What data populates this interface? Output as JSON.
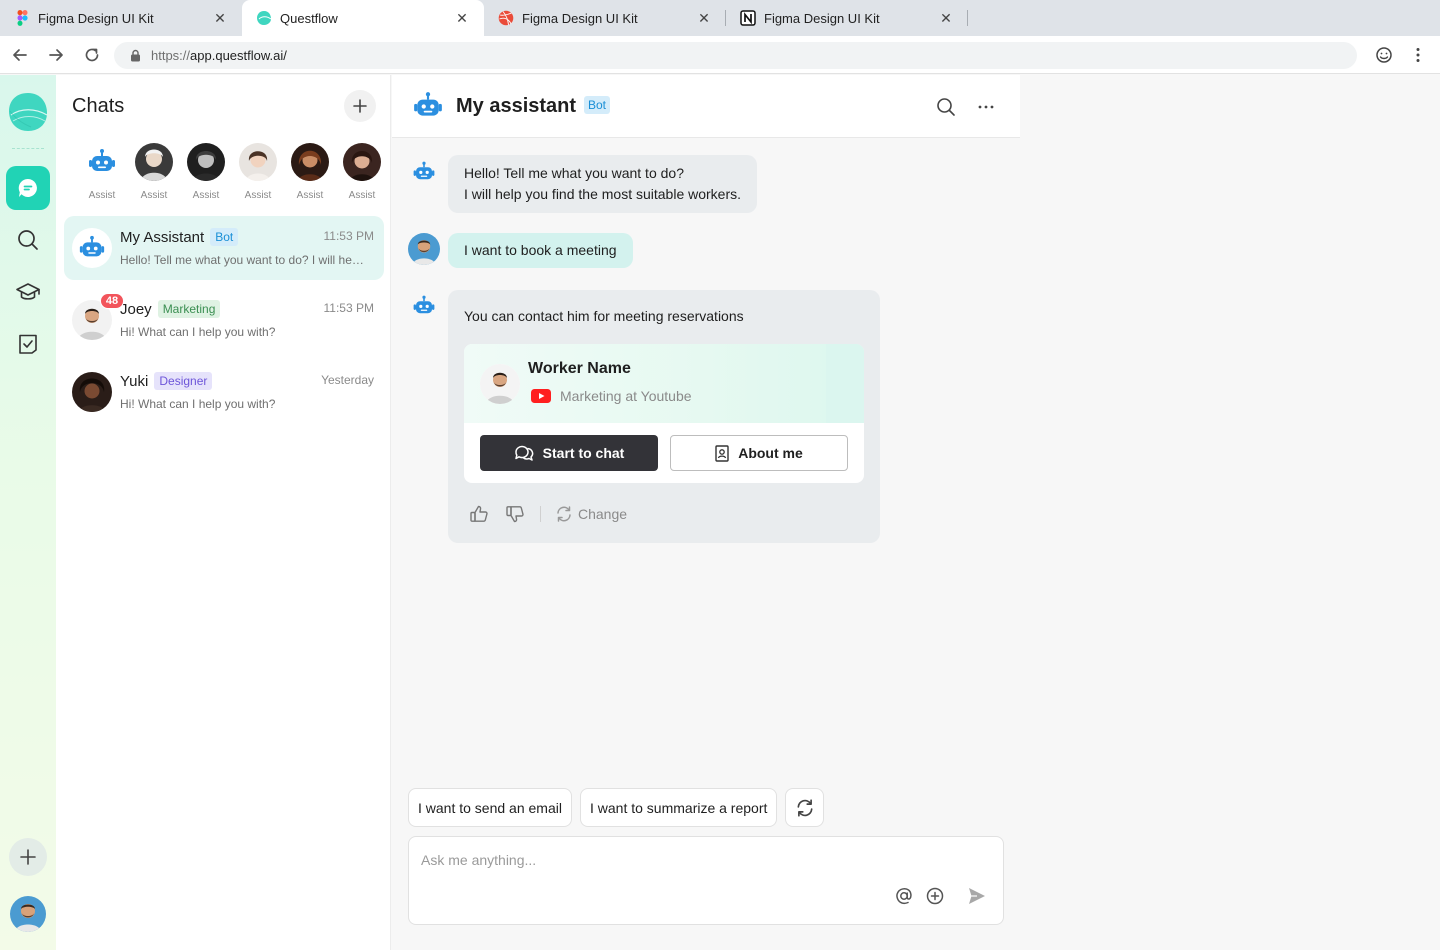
{
  "browser": {
    "tabs": [
      {
        "title": "Figma Design UI Kit",
        "icon": "figma-icon",
        "active": false
      },
      {
        "title": "Questflow",
        "icon": "questflow-icon",
        "active": true
      },
      {
        "title": "Figma Design UI Kit",
        "icon": "dribbble-icon",
        "active": false
      },
      {
        "title": "Figma Design UI Kit",
        "icon": "notion-icon",
        "active": false
      }
    ],
    "url_protocol": "https://",
    "url_host": "app.questflow.ai/"
  },
  "rail": {
    "items": [
      "chat-bubble-icon",
      "search-icon",
      "graduation-cap-icon",
      "checklist-icon"
    ]
  },
  "chats": {
    "title": "Chats",
    "assistants": [
      "Assist",
      "Assist",
      "Assist",
      "Assist",
      "Assist",
      "Assist"
    ],
    "list": [
      {
        "name": "My Assistant",
        "tag": "Bot",
        "time": "11:53  PM",
        "preview": "Hello! Tell me what you want to do? I will help you find the most suitable workers."
      },
      {
        "name": "Joey",
        "tag": "Marketing",
        "time": "11:53  PM",
        "preview": "Hi! What can I help you with?",
        "badge": "48"
      },
      {
        "name": "Yuki",
        "tag": "Designer",
        "time": "Yesterday",
        "preview": "Hi! What can I help you with?"
      }
    ]
  },
  "conversation": {
    "title": "My assistant",
    "tag": "Bot",
    "messages": {
      "bot_greeting_line1": "Hello! Tell me what you want to do?",
      "bot_greeting_line2": "I will help you find the most suitable workers.",
      "user_message": "I want to book a meeting",
      "bot_reply": "You can contact him for meeting reservations"
    },
    "worker_card": {
      "name": "Worker Name",
      "subtitle": "Marketing at Youtube",
      "primary_button": "Start to chat",
      "secondary_button": "About me"
    },
    "change_label": "Change",
    "suggestions": [
      "I want to send an email",
      "I want to summarize a report"
    ],
    "input_placeholder": "Ask me anything..."
  },
  "colors": {
    "accent": "#21d3b5",
    "bot_blue": "#2b8fe0",
    "badge_red": "#f2545b",
    "dark_button": "#333338"
  }
}
